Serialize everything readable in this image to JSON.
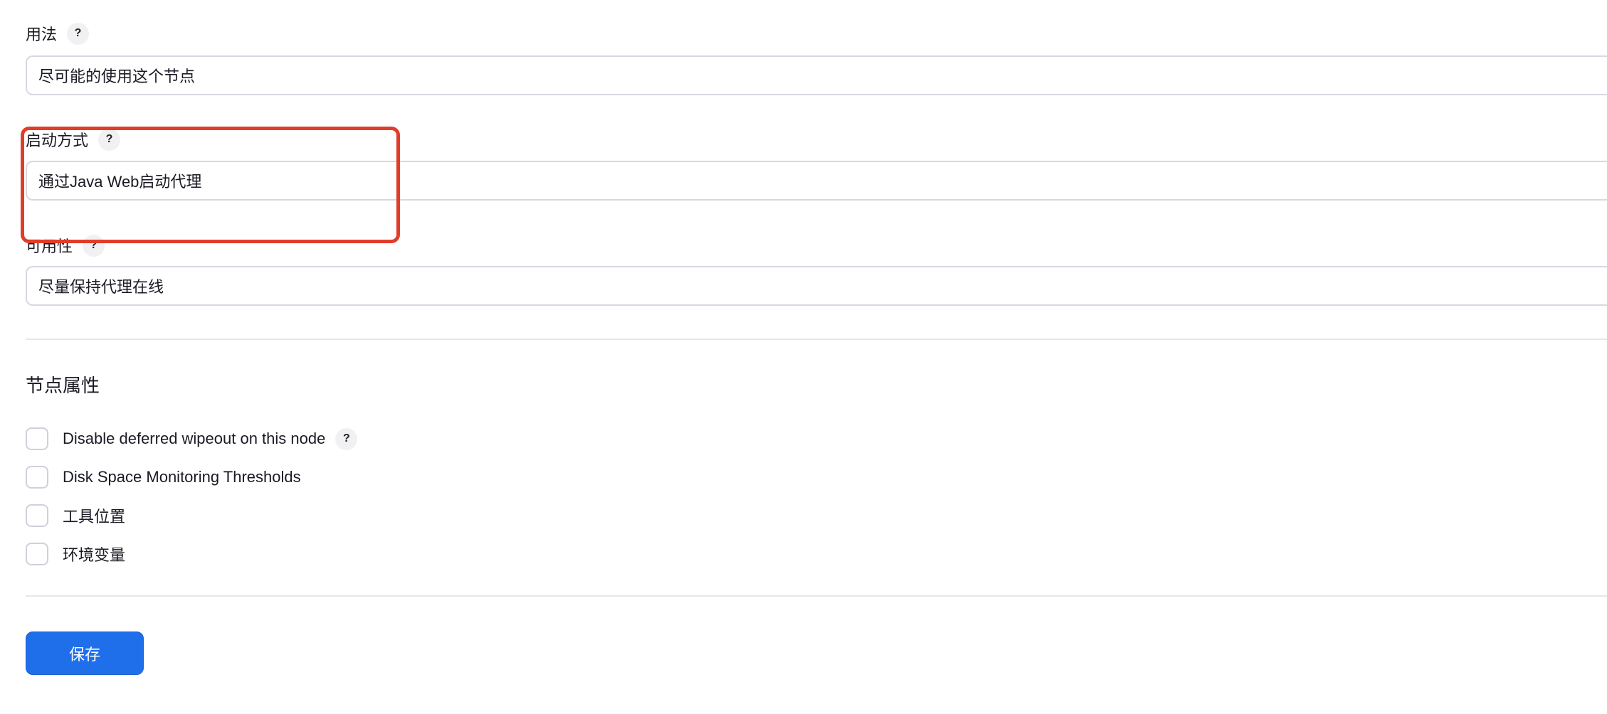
{
  "fields": {
    "usage": {
      "label": "用法",
      "help": "?",
      "value": "尽可能的使用这个节点"
    },
    "launch_method": {
      "label": "启动方式",
      "help": "?",
      "value": "通过Java Web启动代理"
    },
    "availability": {
      "label": "可用性",
      "help": "?",
      "value": "尽量保持代理在线"
    }
  },
  "node_properties": {
    "title": "节点属性",
    "items": [
      {
        "label": "Disable deferred wipeout on this node",
        "help": "?",
        "checked": false
      },
      {
        "label": "Disk Space Monitoring Thresholds",
        "checked": false
      },
      {
        "label": "工具位置",
        "checked": false
      },
      {
        "label": "环境变量",
        "checked": false
      }
    ]
  },
  "actions": {
    "save_label": "保存"
  },
  "colors": {
    "primary_button": "#1f6feb",
    "highlight_box": "#e03d2a",
    "input_border": "#d8d8e3"
  }
}
